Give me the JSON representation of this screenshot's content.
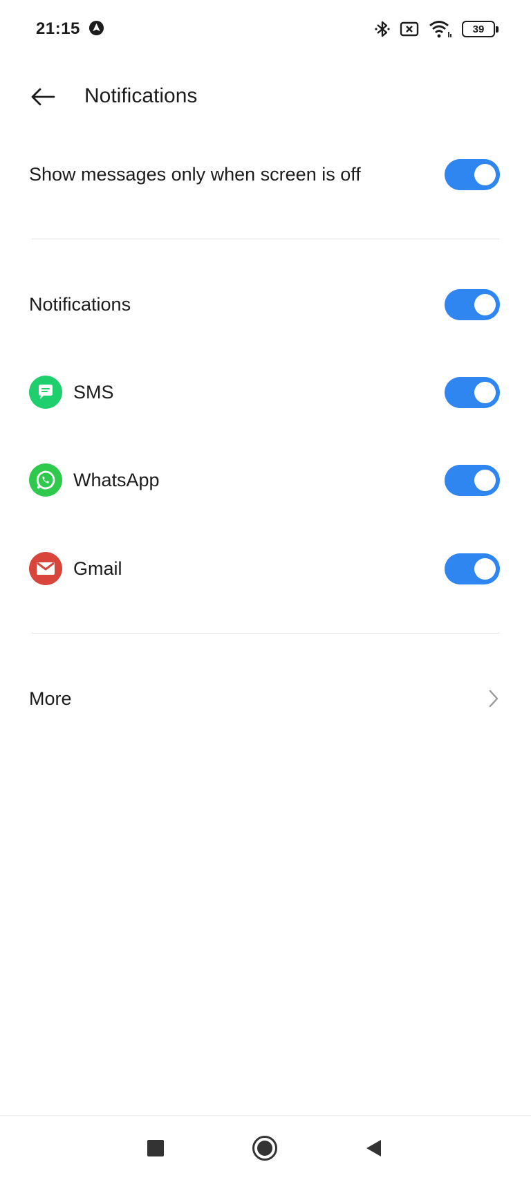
{
  "status_bar": {
    "time": "21:15",
    "app_icon": "android-auto-icon",
    "icons": [
      "bluetooth-icon",
      "sim-x-icon",
      "wifi-icon"
    ],
    "battery_level": "39"
  },
  "header": {
    "back_icon": "arrow-left-icon",
    "title": "Notifications"
  },
  "settings": {
    "show_messages_screen_off": {
      "label": "Show messages only when screen is off",
      "enabled": true
    },
    "notifications": {
      "label": "Notifications",
      "enabled": true
    },
    "apps": [
      {
        "label": "SMS",
        "icon": "sms-icon",
        "color": "#1fcf6e",
        "enabled": true
      },
      {
        "label": "WhatsApp",
        "icon": "whatsapp-icon",
        "color": "#2ec94d",
        "enabled": true
      },
      {
        "label": "Gmail",
        "icon": "gmail-icon",
        "color": "#d8453a",
        "enabled": true
      }
    ],
    "more": {
      "label": "More",
      "icon": "chevron-right-icon"
    }
  },
  "colors": {
    "accent": "#2f86f0"
  },
  "nav_bar": {
    "icons": [
      "recents-square-icon",
      "home-circle-icon",
      "back-triangle-icon"
    ]
  }
}
